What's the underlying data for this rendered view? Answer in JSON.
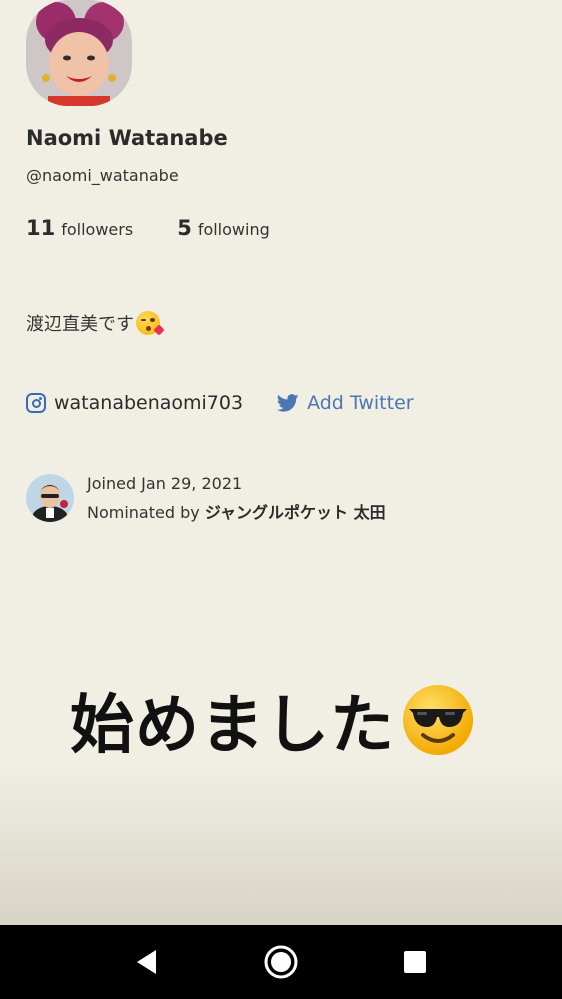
{
  "profile": {
    "name": "Naomi Watanabe",
    "handle": "@naomi_watanabe",
    "followers_count": "11",
    "followers_label": "followers",
    "following_count": "5",
    "following_label": "following",
    "bio_text": "渡辺直美です",
    "bio_emoji": "face-blowing-kiss"
  },
  "links": {
    "instagram_handle": "watanabenaomi703",
    "instagram_icon": "instagram-icon",
    "twitter_label": "Add Twitter",
    "twitter_icon": "twitter-bird-icon",
    "accent_color": "#4e76b1"
  },
  "membership": {
    "joined_text": "Joined Jan 29, 2021",
    "nominated_prefix": "Nominated by",
    "nominated_by": "ジャングルポケット 太田"
  },
  "overlay": {
    "caption_text": "始めました",
    "caption_emoji": "smiling-face-with-sunglasses"
  },
  "system_nav": {
    "back_icon": "back-triangle-icon",
    "home_icon": "home-circle-icon",
    "recents_icon": "recents-square-icon"
  },
  "colors": {
    "background": "#f1efe4",
    "text": "#2b2b2b",
    "link_blue": "#4e76b1",
    "nav_bar": "#000000"
  }
}
